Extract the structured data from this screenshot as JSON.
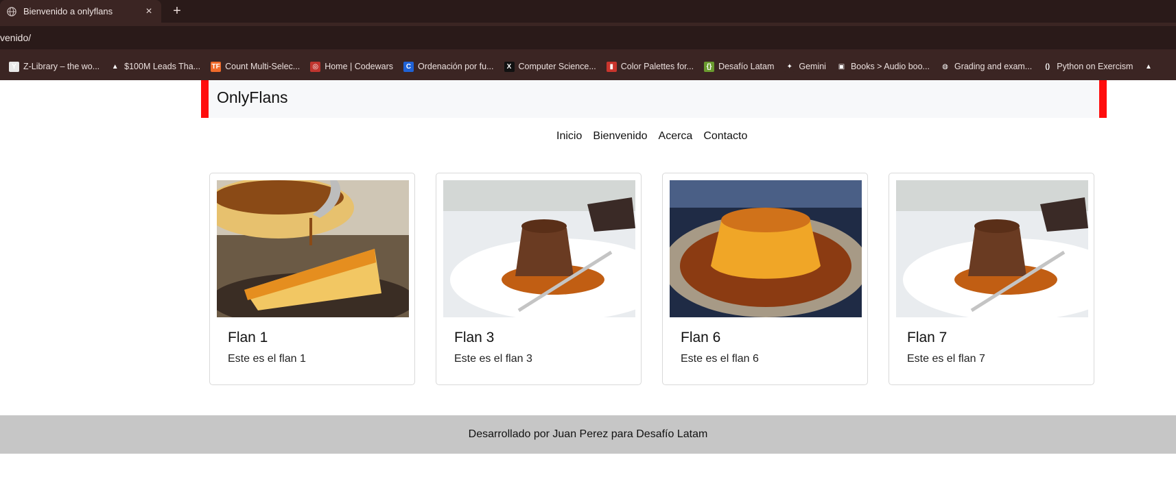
{
  "browser": {
    "tab_title": "Bienvenido a onlyflans",
    "tab_close": "×",
    "new_tab": "+",
    "url": "venido/",
    "bookmarks": [
      {
        "label": "Z-Library – the wo...",
        "icon": "z-library-icon",
        "color": "#e8e8e8",
        "glyph": "Y"
      },
      {
        "label": "$100M Leads Tha...",
        "icon": "triangle-icon",
        "color": "#3b2523",
        "glyph": "▲"
      },
      {
        "label": "Count Multi-Selec...",
        "icon": "tf-icon",
        "color": "#f06a2a",
        "glyph": "TF"
      },
      {
        "label": "Home | Codewars",
        "icon": "codewars-icon",
        "color": "#c0352f",
        "glyph": "◎"
      },
      {
        "label": "Ordenación por fu...",
        "icon": "c-icon",
        "color": "#1f62d6",
        "glyph": "C"
      },
      {
        "label": "Computer Science...",
        "icon": "x-icon",
        "color": "#111111",
        "glyph": "X"
      },
      {
        "label": "Color Palettes for...",
        "icon": "palette-icon",
        "color": "#c9352d",
        "glyph": "▮"
      },
      {
        "label": "Desafío Latam",
        "icon": "desafio-icon",
        "color": "#6a9b2f",
        "glyph": "{}"
      },
      {
        "label": "Gemini",
        "icon": "gemini-icon",
        "color": "#3b2523",
        "glyph": "✦"
      },
      {
        "label": "Books > Audio boo...",
        "icon": "monitor-icon",
        "color": "#3b2523",
        "glyph": "▣"
      },
      {
        "label": "Grading and exam...",
        "icon": "globe-icon",
        "color": "#3b2523",
        "glyph": "◍"
      },
      {
        "label": "Python on Exercism",
        "icon": "exercism-icon",
        "color": "#3b2523",
        "glyph": "()"
      },
      {
        "label": "",
        "icon": "drive-icon",
        "color": "#3b2523",
        "glyph": "▲"
      }
    ]
  },
  "site": {
    "brand": "OnlyFlans",
    "nav": [
      "Inicio",
      "Bienvenido",
      "Acerca",
      "Contacto"
    ],
    "cards": [
      {
        "title": "Flan 1",
        "text": "Este es el flan 1",
        "image": "flan-slice-caramel"
      },
      {
        "title": "Flan 3",
        "text": "Este es el flan 3",
        "image": "chocolate-flan"
      },
      {
        "title": "Flan 6",
        "text": "Este es el flan 6",
        "image": "caramel-flan-plate"
      },
      {
        "title": "Flan 7",
        "text": "Este es el flan 7",
        "image": "chocolate-flan"
      }
    ],
    "footer": "Desarrollado por Juan Perez para Desafío Latam"
  },
  "colors": {
    "accent_red": "#ff0d0d",
    "footer_bg": "#c6c6c6",
    "chrome_dark": "#2a1a19"
  }
}
